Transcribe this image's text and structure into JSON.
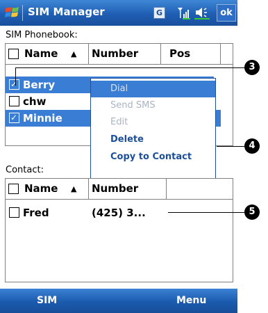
{
  "titlebar": {
    "title": "SIM Manager",
    "g_indicator": "G",
    "ok": "ok"
  },
  "sim_section": {
    "label": "SIM Phonebook:",
    "columns": [
      "Name",
      "Number",
      "Pos"
    ],
    "sort_indicator": "▲",
    "rows": [
      {
        "name": "Berry",
        "checked": true,
        "selected": true
      },
      {
        "name": "chw",
        "checked": false,
        "selected": false
      },
      {
        "name": "Minnie",
        "checked": true,
        "selected": true
      }
    ]
  },
  "context_menu": {
    "items": [
      {
        "label": "Dial",
        "state": "highlighted"
      },
      {
        "label": "Send SMS",
        "state": "disabled"
      },
      {
        "label": "Edit",
        "state": "disabled"
      },
      {
        "label": "Delete",
        "state": "enabled"
      },
      {
        "label": "Copy to Contact",
        "state": "enabled"
      }
    ]
  },
  "contact_section": {
    "label": "Contact:",
    "columns": [
      "Name",
      "Number"
    ],
    "sort_indicator": "▲",
    "rows": [
      {
        "name": "Fred",
        "number": "(425) 3..."
      }
    ]
  },
  "callouts": [
    "3",
    "4",
    "5"
  ],
  "softkeys": {
    "left": "SIM",
    "right": "Menu"
  },
  "colors": {
    "accent": "#3a7dd4",
    "titlebar": "#1f5eb3",
    "menu_text": "#1c4f98"
  }
}
